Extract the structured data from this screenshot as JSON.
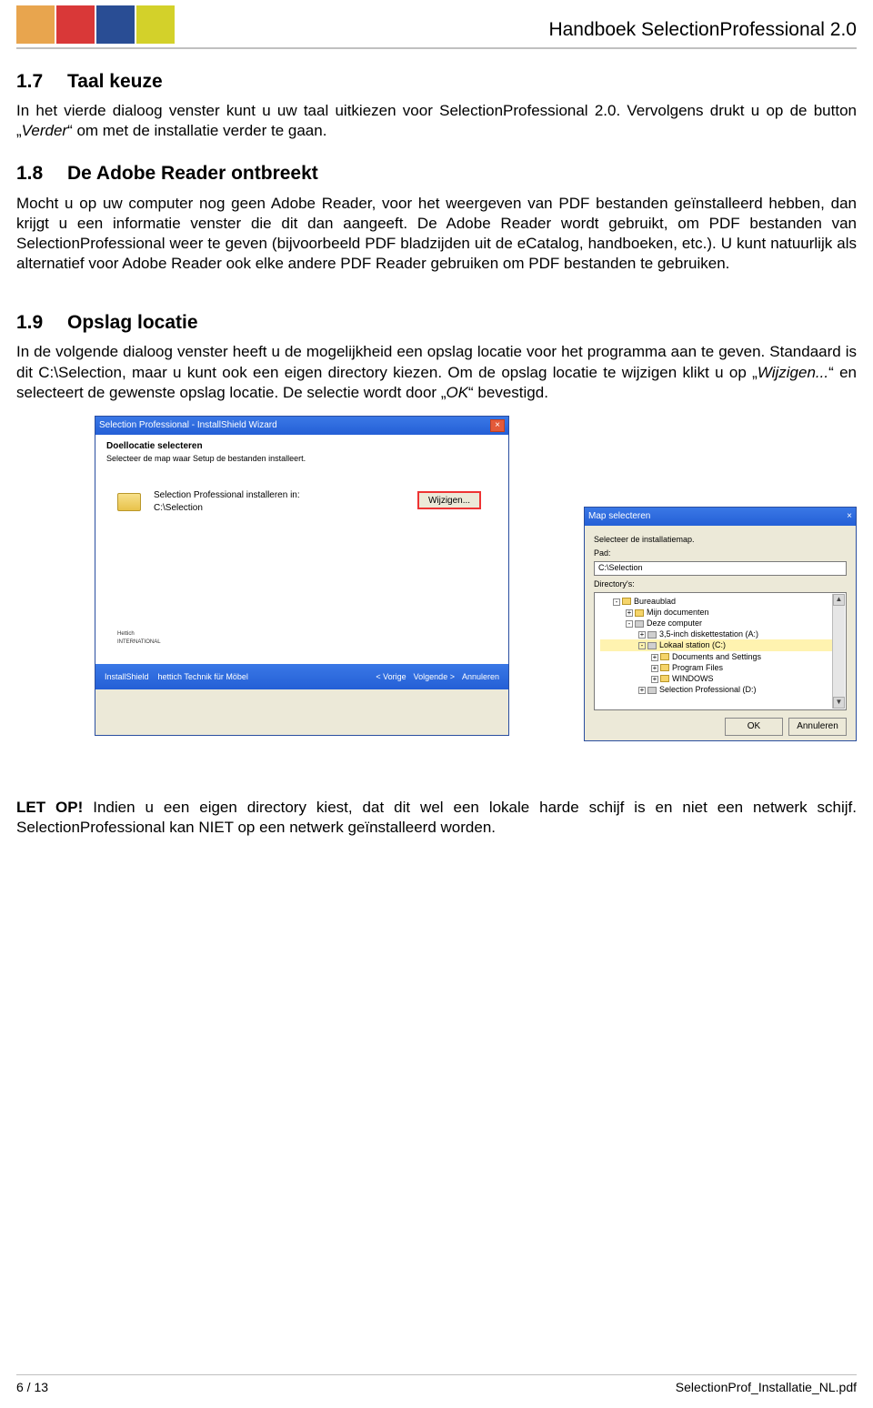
{
  "header": {
    "doc_title": "Handboek SelectionProfessional 2.0"
  },
  "s17": {
    "num": "1.7",
    "title": "Taal keuze",
    "p1a": "In het vierde dialoog venster kunt u uw taal uitkiezen voor SelectionProfessional 2.0. Vervolgens drukt u op de button „",
    "p1i": "Verder",
    "p1b": "“ om met de installatie verder te gaan."
  },
  "s18": {
    "num": "1.8",
    "title": "De Adobe Reader ontbreekt",
    "p1": "Mocht u op uw computer nog geen Adobe Reader, voor het weergeven van PDF bestanden geïnstalleerd hebben, dan krijgt u een informatie venster die dit dan aangeeft. De Adobe Reader wordt gebruikt, om PDF bestanden van SelectionProfessional weer te geven (bijvoorbeeld PDF bladzijden uit de eCatalog, handboeken, etc.). U kunt natuurlijk als alternatief voor Adobe Reader ook elke andere PDF Reader gebruiken om PDF bestanden te gebruiken."
  },
  "s19": {
    "num": "1.9",
    "title": "Opslag locatie",
    "p1a": "In de volgende dialoog venster heeft u de mogelijkheid een opslag locatie voor het programma aan te geven. Standaard is dit C:\\Selection, maar u kunt ook een eigen directory kiezen. Om de opslag locatie te wijzigen klikt u op „",
    "p1i": "Wijzigen...",
    "p1b": "“ en selecteert de gewenste opslag locatie. De selectie wordt door „",
    "p1i2": "OK",
    "p1c": "“ bevestigd."
  },
  "win1": {
    "title": "Selection Professional - InstallShield Wizard",
    "sub1": "Doellocatie selecteren",
    "sub2": "Selecteer de map waar Setup de bestanden installeert.",
    "install_label": "Selection Professional installeren in:",
    "install_path": "C:\\Selection",
    "wijzigen": "Wijzigen...",
    "brand": "Hettich",
    "brand_sub": "INTERNATIONAL",
    "footer_brand": "InstallShield",
    "footer_tag": "hettich  Technik für Möbel",
    "btn_back": "< Vorige",
    "btn_next": "Volgende >",
    "btn_cancel": "Annuleren"
  },
  "win2": {
    "title": "Map selecteren",
    "instr": "Selecteer de installatiemap.",
    "path_label": "Pad:",
    "path_value": "C:\\Selection",
    "dir_label": "Directory's:",
    "tree": {
      "i0": "Bureaublad",
      "i1": "Mijn documenten",
      "i2": "Deze computer",
      "i3": "3,5-inch diskettestation (A:)",
      "i4": "Lokaal station (C:)",
      "i5": "Documents and Settings",
      "i6": "Program Files",
      "i7": "WINDOWS",
      "i8": "Selection Professional (D:)"
    },
    "ok": "OK",
    "cancel": "Annuleren"
  },
  "letop": {
    "label": "LET OP!",
    "text": " Indien u een eigen directory kiest, dat dit wel een lokale harde schijf is en niet een netwerk schijf. SelectionProfessional kan NIET op een netwerk geïnstalleerd worden."
  },
  "footer": {
    "page": "6 / 13",
    "file": "SelectionProf_Installatie_NL.pdf"
  }
}
